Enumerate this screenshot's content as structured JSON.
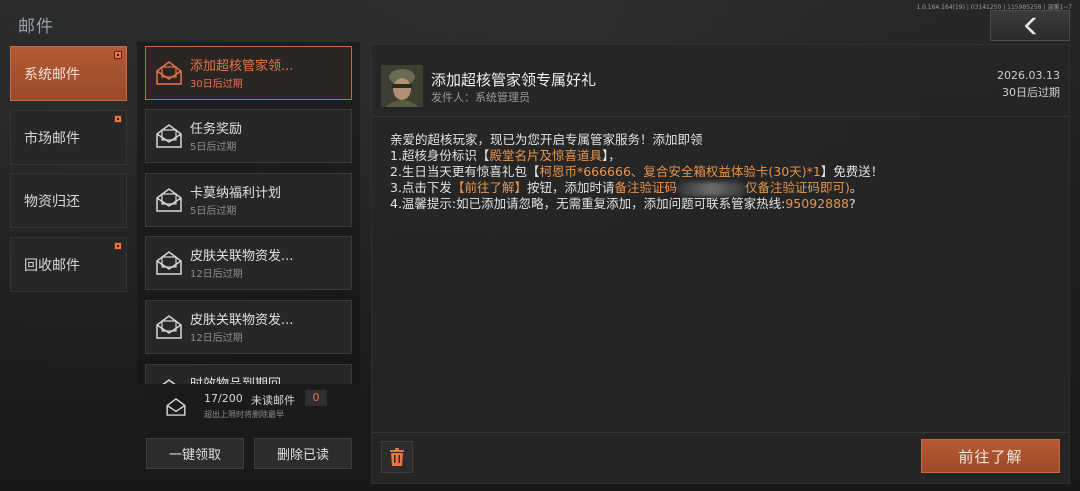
{
  "header": {
    "title": "邮件",
    "version": "1.0.164.164(19) | 03141250 | 115985258 | 温暖1~7",
    "back_icon": "chevron-left-icon"
  },
  "categories": [
    {
      "label": "系统邮件",
      "active": true,
      "badge": true
    },
    {
      "label": "市场邮件",
      "active": false,
      "badge": true
    },
    {
      "label": "物资归还",
      "active": false,
      "badge": false
    },
    {
      "label": "回收邮件",
      "active": false,
      "badge": true
    }
  ],
  "mails": [
    {
      "title": "添加超核管家领...",
      "expire": "30日后过期",
      "active": true
    },
    {
      "title": "任务奖励",
      "expire": "5日后过期",
      "active": false
    },
    {
      "title": "卡莫纳福利计划",
      "expire": "5日后过期",
      "active": false
    },
    {
      "title": "皮肤关联物资发...",
      "expire": "12日后过期",
      "active": false
    },
    {
      "title": "皮肤关联物资发...",
      "expire": "12日后过期",
      "active": false
    },
    {
      "title": "时效物品到期回...",
      "expire": "",
      "active": false
    }
  ],
  "counter": {
    "count": "17/200",
    "unread_label": "未读邮件",
    "unread_count": "0",
    "hint": "超出上限时将删除最早"
  },
  "buttons": {
    "claim_all": "一键领取",
    "delete_read": "删除已读",
    "go": "前往了解"
  },
  "detail": {
    "title": "添加超核管家领专属好礼",
    "sender": "发件人：系统管理员",
    "date": "2026.03.13",
    "expire": "30日后过期",
    "lines": {
      "l1": "亲爱的超核玩家，现已为您开启专属管家服务！添加即领",
      "l2_a": "1.超核身份标识【",
      "l2_b": "殿堂名片及惊喜道具",
      "l2_c": "】，",
      "l3_a": "2.生日当天更有惊喜礼包【",
      "l3_b": "柯恩币*666666、复合安全箱权益体验卡(30天)*1",
      "l3_c": "】免费送！",
      "l4_a": "3.点击下发",
      "l4_b": "【前往了解】",
      "l4_c": "按钮，添加时请",
      "l4_d": "备注验证码",
      "l4_e": "仅备注验证码即可)",
      "l4_f": "。",
      "l5_a": "4.温馨提示:如已添加请忽略，无需重复添加，添加问题可联系管家热线:",
      "l5_b": "95092888",
      "l5_c": "?"
    }
  },
  "colors": {
    "accent": "#e8744a",
    "highlight": "#e8944a",
    "button": "#b55a33"
  }
}
